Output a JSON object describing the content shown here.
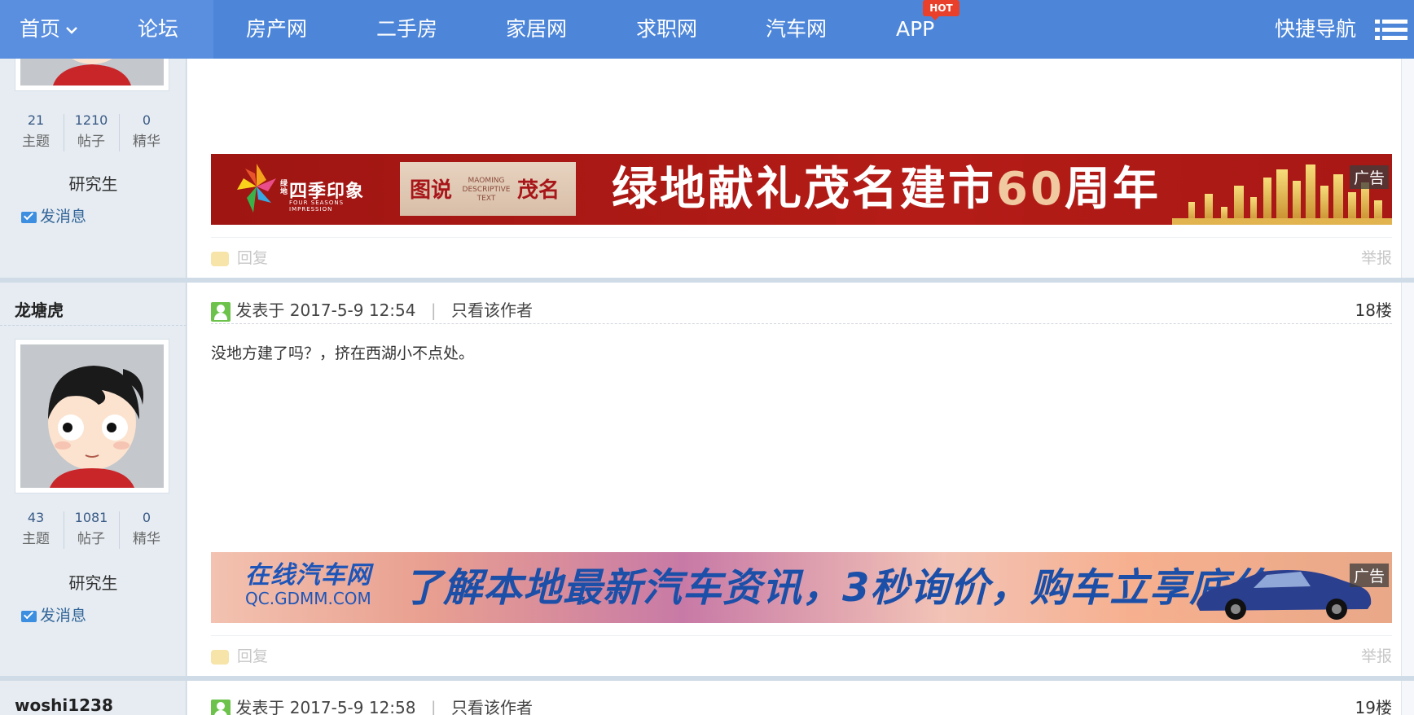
{
  "nav": {
    "items": [
      {
        "label": "首页",
        "has_chevron": true
      },
      {
        "label": "论坛"
      },
      {
        "label": "房产网"
      },
      {
        "label": "二手房"
      },
      {
        "label": "家居网"
      },
      {
        "label": "求职网"
      },
      {
        "label": "汽车网"
      },
      {
        "label": "APP"
      }
    ],
    "hot_badge": "HOT",
    "quick_nav": "快捷导航",
    "menu_icon": "hamburger-menu-icon",
    "bar_color": "#4d86d9"
  },
  "posts": [
    {
      "stats": [
        {
          "value": "21",
          "label": "主题"
        },
        {
          "value": "1210",
          "label": "帖子"
        },
        {
          "value": "0",
          "label": "精华"
        }
      ],
      "rank": "研究生",
      "send_message": "发消息",
      "ad": {
        "type": "greenland",
        "logo_main": "四季印象",
        "logo_small": "绿地",
        "logo_sub": "FOUR SEASONS IMPRESSION",
        "badge_left": "图说",
        "badge_mid": "MAOMING DESCRIPTIVE TEXT",
        "badge_right": "茂名",
        "slogan_prefix": "绿地献礼茂名建市",
        "slogan_num": "60",
        "slogan_suffix": "周年",
        "tag": "广告"
      },
      "reply": "回复",
      "report": "举报"
    },
    {
      "author": "龙塘虎",
      "posted_at": "发表于 2017-5-9 12:54",
      "only_author": "只看该作者",
      "floor": "18楼",
      "content": "没地方建了吗？，挤在西湖小不点处。",
      "stats": [
        {
          "value": "43",
          "label": "主题"
        },
        {
          "value": "1081",
          "label": "帖子"
        },
        {
          "value": "0",
          "label": "精华"
        }
      ],
      "rank": "研究生",
      "send_message": "发消息",
      "ad": {
        "type": "car",
        "brand_line1": "在线汽车网",
        "brand_line2": "QC.GDMM.COM",
        "slogan": "了解本地最新汽车资讯，3秒询价，购车立享底价",
        "tag": "广告"
      },
      "reply": "回复",
      "report": "举报"
    },
    {
      "author": "woshi1238",
      "posted_at": "发表于 2017-5-9 12:58",
      "only_author": "只看该作者",
      "floor": "19楼"
    }
  ]
}
